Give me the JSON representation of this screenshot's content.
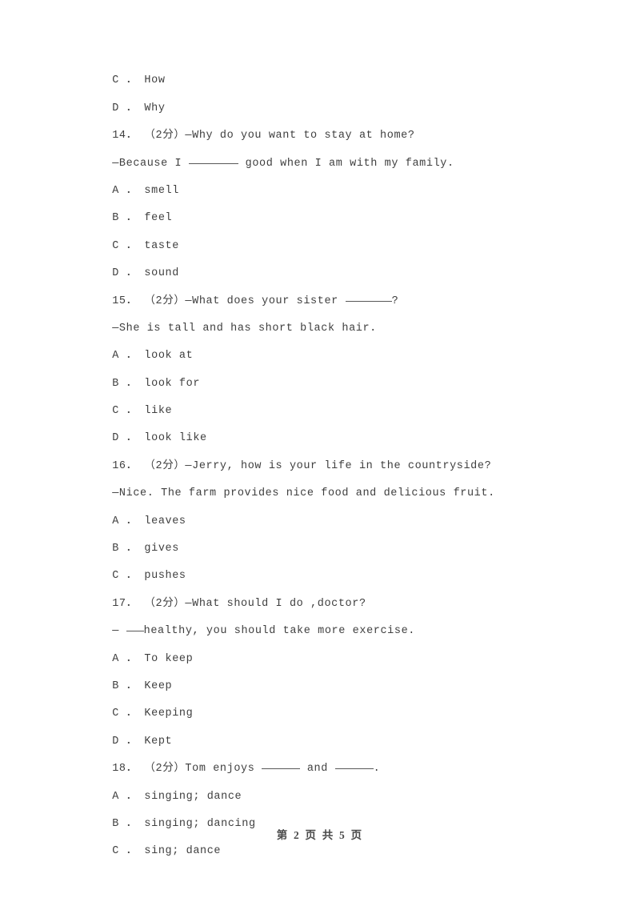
{
  "document": {
    "type": "exam-paper",
    "language": "en-zh",
    "background_color": "#ffffff",
    "text_color": "#3f3f3f"
  },
  "lines": [
    {
      "id": "l1",
      "kind": "option",
      "text": "C ． How"
    },
    {
      "id": "l2",
      "kind": "option",
      "text": "D ． Why"
    },
    {
      "id": "l3",
      "kind": "question",
      "text": "14． （2分）—Why do you want to stay at home?"
    },
    {
      "id": "l4",
      "kind": "answer",
      "pre": "—Because I ",
      "blank": "long",
      "post": " good when I am with my family."
    },
    {
      "id": "l5",
      "kind": "option",
      "text": "A ． smell"
    },
    {
      "id": "l6",
      "kind": "option",
      "text": "B ． feel"
    },
    {
      "id": "l7",
      "kind": "option",
      "text": "C ． taste"
    },
    {
      "id": "l8",
      "kind": "option",
      "text": "D ． sound"
    },
    {
      "id": "l9",
      "kind": "question",
      "pre": "15． （2分）—What does your sister ",
      "blank": "mid",
      "post": "?"
    },
    {
      "id": "l10",
      "kind": "answer",
      "text": "—She is tall and has short black hair."
    },
    {
      "id": "l11",
      "kind": "option",
      "text": "A ． look at"
    },
    {
      "id": "l12",
      "kind": "option",
      "text": "B ． look for"
    },
    {
      "id": "l13",
      "kind": "option",
      "text": "C ． like"
    },
    {
      "id": "l14",
      "kind": "option",
      "text": "D ． look like"
    },
    {
      "id": "l15",
      "kind": "question",
      "text": "16． （2分）—Jerry, how is your life in the countryside?"
    },
    {
      "id": "l16",
      "kind": "answer",
      "text": "—Nice. The farm provides nice food and delicious fruit."
    },
    {
      "id": "l17",
      "kind": "option",
      "text": "A ． leaves"
    },
    {
      "id": "l18",
      "kind": "option",
      "text": "B ． gives"
    },
    {
      "id": "l19",
      "kind": "option",
      "text": "C ． pushes"
    },
    {
      "id": "l20",
      "kind": "question",
      "text": "17． （2分）—What should I do ,doctor?"
    },
    {
      "id": "l21",
      "kind": "answer",
      "pre": "— ",
      "blank": "tiny",
      "post": "healthy, you should take more exercise."
    },
    {
      "id": "l22",
      "kind": "option",
      "text": "A ． To keep"
    },
    {
      "id": "l23",
      "kind": "option",
      "text": "B ． Keep"
    },
    {
      "id": "l24",
      "kind": "option",
      "text": "C ． Keeping"
    },
    {
      "id": "l25",
      "kind": "option",
      "text": "D ． Kept"
    },
    {
      "id": "l26",
      "kind": "question",
      "pre": "18． （2分）Tom enjoys ",
      "blank": "short",
      "mid": " and ",
      "blank2": "short",
      "post": "."
    },
    {
      "id": "l27",
      "kind": "option",
      "text": "A ． singing; dance"
    },
    {
      "id": "l28",
      "kind": "option",
      "text": "B ． singing; dancing"
    },
    {
      "id": "l29",
      "kind": "option",
      "text": "C ． sing; dance"
    }
  ],
  "footer": {
    "text": "第 2 页 共 5 页",
    "page_number": "2",
    "total_pages": "5"
  }
}
